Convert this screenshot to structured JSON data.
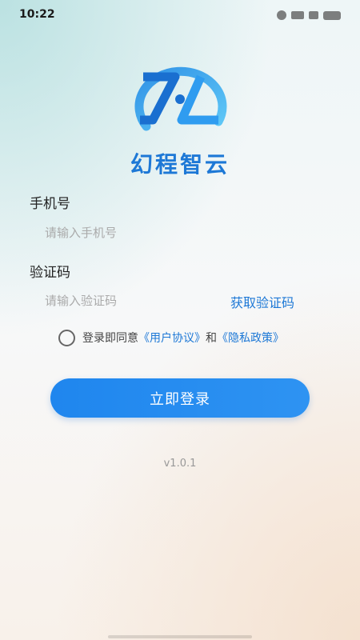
{
  "status_bar": {
    "time": "10:22"
  },
  "app": {
    "name": "幻程智云",
    "brand_color": "#1d78d6",
    "logo_icon": "zl-logo-icon"
  },
  "phone": {
    "label": "手机号",
    "placeholder": "请输入手机号",
    "value": ""
  },
  "code": {
    "label": "验证码",
    "placeholder": "请输入验证码",
    "value": "",
    "get_code_label": "获取验证码"
  },
  "agreement": {
    "checked": false,
    "prefix": "登录即同意",
    "user_agreement": "《用户协议》",
    "and": "和",
    "privacy_policy": "《隐私政策》"
  },
  "login_button": {
    "label": "立即登录"
  },
  "version": "v1.0.1"
}
